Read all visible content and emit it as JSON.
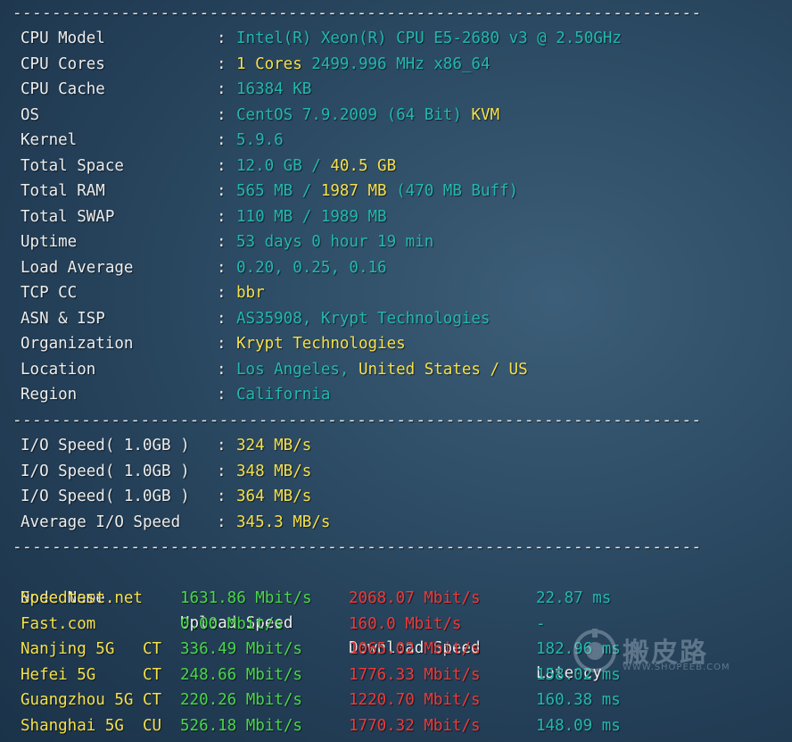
{
  "separator": "----------------------------------------------------------------------",
  "sysinfo": [
    {
      "label": "CPU Model",
      "parts": [
        {
          "t": "Intel(R) Xeon(R) CPU E5-2680 v3 @ 2.50GHz",
          "c": "cyan"
        }
      ]
    },
    {
      "label": "CPU Cores",
      "parts": [
        {
          "t": "1 Cores",
          "c": "yellow"
        },
        {
          "t": " 2499.996 MHz x86_64",
          "c": "cyan"
        }
      ]
    },
    {
      "label": "CPU Cache",
      "parts": [
        {
          "t": "16384 KB",
          "c": "cyan"
        }
      ]
    },
    {
      "label": "OS",
      "parts": [
        {
          "t": "CentOS 7.9.2009 (64 Bit)",
          "c": "cyan"
        },
        {
          "t": " KVM",
          "c": "yellow"
        }
      ]
    },
    {
      "label": "Kernel",
      "parts": [
        {
          "t": "5.9.6",
          "c": "cyan"
        }
      ]
    },
    {
      "label": "Total Space",
      "parts": [
        {
          "t": "12.0 GB / ",
          "c": "cyan"
        },
        {
          "t": "40.5 GB",
          "c": "yellow"
        }
      ]
    },
    {
      "label": "Total RAM",
      "parts": [
        {
          "t": "565 MB / ",
          "c": "cyan"
        },
        {
          "t": "1987 MB",
          "c": "yellow"
        },
        {
          "t": " (470 MB Buff)",
          "c": "cyan"
        }
      ]
    },
    {
      "label": "Total SWAP",
      "parts": [
        {
          "t": "110 MB / 1989 MB",
          "c": "cyan"
        }
      ]
    },
    {
      "label": "Uptime",
      "parts": [
        {
          "t": "53 days 0 hour 19 min",
          "c": "cyan"
        }
      ]
    },
    {
      "label": "Load Average",
      "parts": [
        {
          "t": "0.20, 0.25, 0.16",
          "c": "cyan"
        }
      ]
    },
    {
      "label": "TCP CC",
      "parts": [
        {
          "t": "bbr",
          "c": "yellow"
        }
      ]
    },
    {
      "label": "ASN & ISP",
      "parts": [
        {
          "t": "AS35908, Krypt Technologies",
          "c": "cyan"
        }
      ]
    },
    {
      "label": "Organization",
      "parts": [
        {
          "t": "Krypt Technologies",
          "c": "yellow"
        }
      ]
    },
    {
      "label": "Location",
      "parts": [
        {
          "t": "Los Angeles, ",
          "c": "cyan"
        },
        {
          "t": "United States / US",
          "c": "yellow"
        }
      ]
    },
    {
      "label": "Region",
      "parts": [
        {
          "t": "California",
          "c": "cyan"
        }
      ]
    }
  ],
  "io": [
    {
      "label": "I/O Speed( 1.0GB )",
      "value": "324 MB/s"
    },
    {
      "label": "I/O Speed( 1.0GB )",
      "value": "348 MB/s"
    },
    {
      "label": "I/O Speed( 1.0GB )",
      "value": "364 MB/s"
    },
    {
      "label": "Average I/O Speed",
      "value": "345.3 MB/s"
    }
  ],
  "speed_header": {
    "node": "Node Name",
    "upload": "Upload Speed",
    "download": "Download Speed",
    "latency": "Latency"
  },
  "speed_rows": [
    {
      "node": "Speedtest.net",
      "isp": "",
      "upload": "1631.86 Mbit/s",
      "download": "2068.07 Mbit/s",
      "latency": "22.87 ms"
    },
    {
      "node": "Fast.com",
      "isp": "",
      "upload": "0.00 Mbit/s",
      "download": "160.0 Mbit/s",
      "latency": "-"
    },
    {
      "node": "Nanjing 5G",
      "isp": "CT",
      "upload": "336.49 Mbit/s",
      "download": "1065.02 Mbit/s",
      "latency": "182.96 ms"
    },
    {
      "node": "Hefei 5G",
      "isp": "CT",
      "upload": "248.66 Mbit/s",
      "download": "1776.33 Mbit/s",
      "latency": "158.02 ms"
    },
    {
      "node": "Guangzhou 5G",
      "isp": "CT",
      "upload": "220.26 Mbit/s",
      "download": "1220.70 Mbit/s",
      "latency": "160.38 ms"
    },
    {
      "node": "Shanghai 5G",
      "isp": "CU",
      "upload": "526.18 Mbit/s",
      "download": "1770.32 Mbit/s",
      "latency": "148.09 ms"
    }
  ],
  "watermark": {
    "text": "搬皮路",
    "sub": "WWW.SHOPEEB.COM"
  },
  "colors": {
    "cyan": "#22b8b0",
    "yellow": "#f5e04a",
    "green": "#4ad64a",
    "red": "#ee3a3a"
  }
}
